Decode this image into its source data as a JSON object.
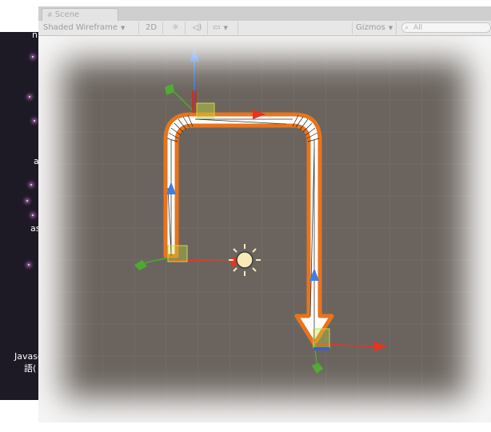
{
  "window": {
    "tab_label": "Scene",
    "tab_icon": "scene-icon"
  },
  "toolbar": {
    "draw_mode": "Shaded Wireframe",
    "mode_2d": "2D",
    "lighting_icon": "sun-icon",
    "audio_icon": "speaker-icon",
    "effects_icon": "image-icon",
    "gizmos": "Gizmos",
    "search_placeholder": "All"
  },
  "background_text": {
    "left_top": "n",
    "left_mid_1": "a",
    "left_mid_2": "as",
    "left_bottom_1": "Javasc",
    "left_bottom_2": "語("
  },
  "colors": {
    "viewport_bg": "#6b645e",
    "path_outline": "#e8741c",
    "path_fill": "#ffffff",
    "axis_x": "#e8341c",
    "axis_y": "#3f7fe0",
    "axis_z": "#4fa832"
  }
}
